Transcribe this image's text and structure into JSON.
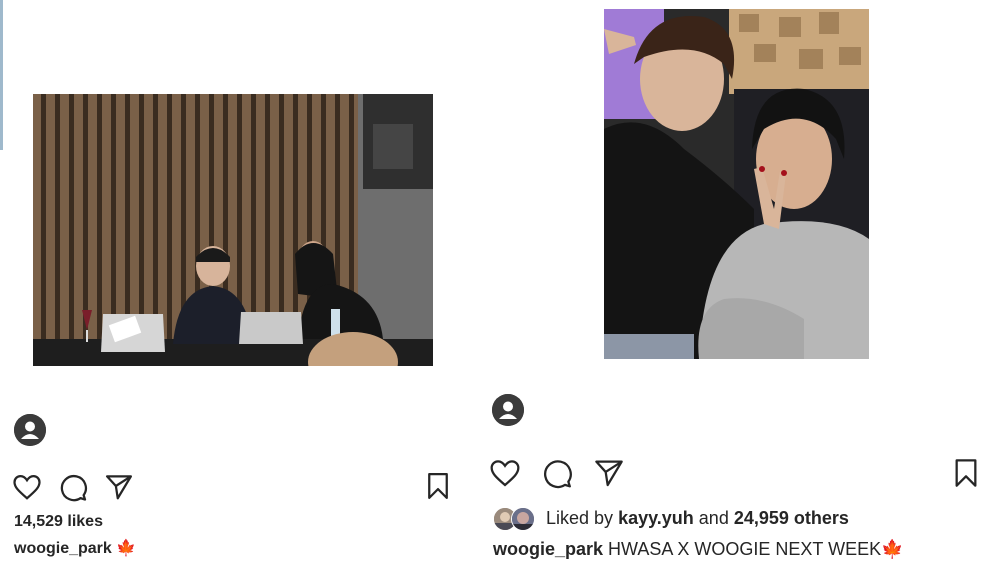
{
  "post_left": {
    "likes": "14,529 likes",
    "username": "woogie_park",
    "caption_emoji": "🍁"
  },
  "post_right": {
    "liked_by_prefix": "Liked by",
    "liked_by_user": "kayy.yuh",
    "liked_by_middle": "and",
    "liked_by_count": "24,959 others",
    "username": "woogie_park",
    "caption": "HWASA X WOOGIE NEXT WEEK",
    "caption_emoji": "🍁"
  },
  "icons": {
    "like": "heart-icon",
    "comment": "comment-icon",
    "share": "paper-plane-icon",
    "save": "bookmark-icon",
    "avatar": "default-avatar-icon"
  }
}
